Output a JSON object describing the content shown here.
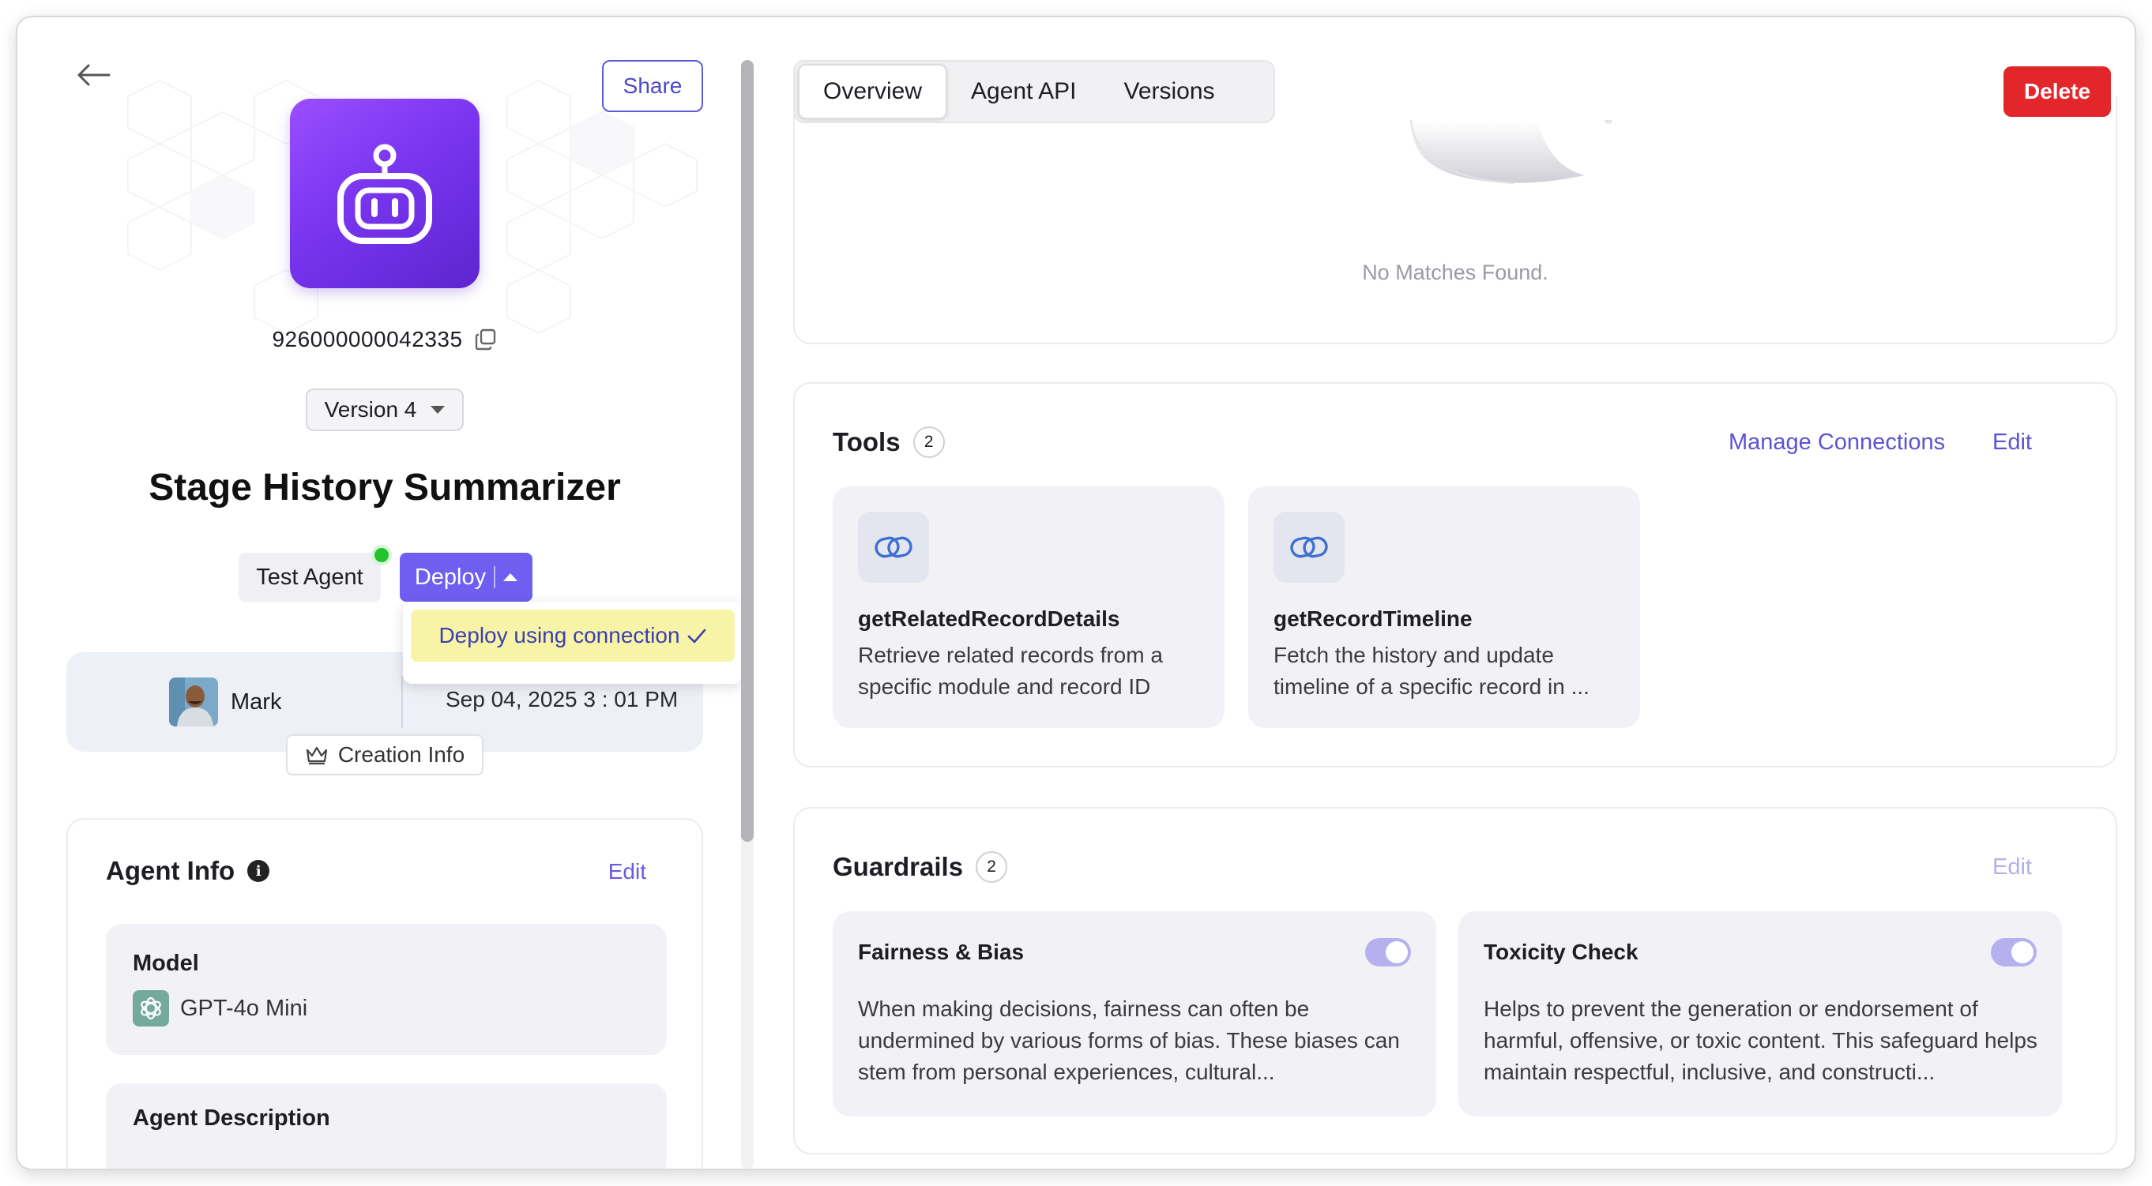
{
  "header": {
    "share_label": "Share",
    "delete_label": "Delete"
  },
  "agent": {
    "id": "926000000042335",
    "version_selected": "Version 4",
    "title": "Stage History Summarizer",
    "status_color": "#22c32b"
  },
  "actions": {
    "test_agent_label": "Test Agent",
    "deploy_label": "Deploy",
    "deploy_menu_item": "Deploy using connection"
  },
  "creation": {
    "creator_name": "Mark",
    "date": "Sep 04, 2025   3 : 01 PM",
    "tag_label": "Creation Info"
  },
  "agent_info": {
    "title": "Agent Info",
    "edit_label": "Edit",
    "model_label": "Model",
    "model_value": "GPT-4o Mini",
    "description_label": "Agent Description"
  },
  "tabs": [
    {
      "label": "Overview",
      "active": true
    },
    {
      "label": "Agent API",
      "active": false
    },
    {
      "label": "Versions",
      "active": false
    }
  ],
  "top_card": {
    "empty_text": "No Matches Found."
  },
  "tools": {
    "title": "Tools",
    "count": "2",
    "manage_label": "Manage Connections",
    "edit_label": "Edit",
    "items": [
      {
        "name": "getRelatedRecordDetails",
        "description": "Retrieve related records from a specific module and record ID",
        "icon": "link-icon"
      },
      {
        "name": "getRecordTimeline",
        "description": "Fetch the history and update timeline of a specific record in ...",
        "icon": "link-icon"
      }
    ]
  },
  "guardrails": {
    "title": "Guardrails",
    "count": "2",
    "edit_label": "Edit",
    "items": [
      {
        "name": "Fairness & Bias",
        "enabled": true,
        "description": "When making decisions, fairness can often be undermined by various forms of bias. These biases can stem from personal experiences, cultural..."
      },
      {
        "name": "Toxicity Check",
        "enabled": true,
        "description": "Helps to prevent the generation or endorsement of harmful, offensive, or toxic content. This safeguard helps maintain respectful, inclusive, and constructi..."
      }
    ]
  },
  "colors": {
    "accent": "#6f5ff0",
    "link": "#5c52d6",
    "danger": "#e3262a",
    "highlight": "#f7f4a8"
  }
}
